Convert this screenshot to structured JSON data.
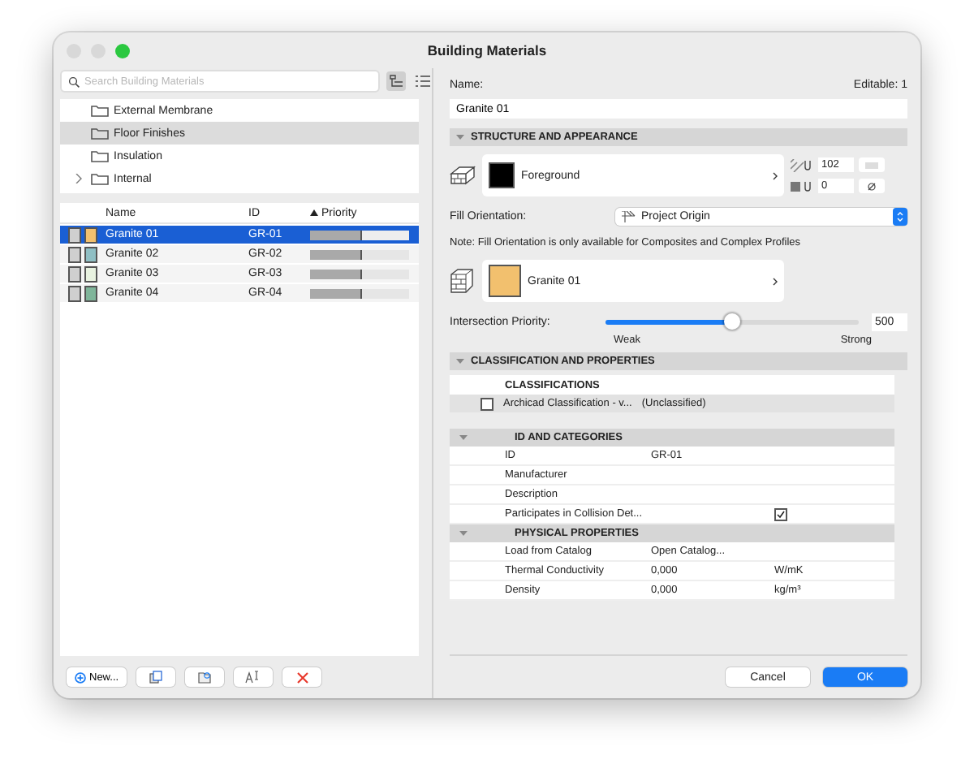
{
  "window": {
    "title": "Building Materials"
  },
  "search": {
    "placeholder": "Search Building Materials"
  },
  "view_toggle": [
    {
      "kind": "tree",
      "selected": true
    },
    {
      "kind": "list",
      "selected": false
    }
  ],
  "tree": {
    "items": [
      {
        "label": "External Membrane",
        "selected": false
      },
      {
        "label": "Floor Finishes",
        "selected": true
      },
      {
        "label": "Insulation",
        "selected": false
      },
      {
        "label": "Internal",
        "selected": false,
        "expanded": false
      }
    ]
  },
  "table": {
    "columns": [
      {
        "label": "Name",
        "sorted": false
      },
      {
        "label": "ID",
        "sorted": false
      },
      {
        "label": "Priority",
        "sorted": true
      }
    ],
    "rows": [
      {
        "name": "Granite 01",
        "id": "GR-01",
        "color": "#f2c06e",
        "level": 0.5,
        "selected": true
      },
      {
        "name": "Granite 02",
        "id": "GR-02",
        "color": "#8fbfc4",
        "level": 0.5,
        "selected": false
      },
      {
        "name": "Granite 03",
        "id": "GR-03",
        "color": "#e8f2e0",
        "level": 0.5,
        "selected": false
      },
      {
        "name": "Granite 04",
        "id": "GR-04",
        "color": "#7fb59a",
        "level": 0.5,
        "selected": false
      }
    ]
  },
  "left_buttons": [
    {
      "kind": "new",
      "label": "New..."
    },
    {
      "kind": "duplicate"
    },
    {
      "kind": "import"
    },
    {
      "kind": "rename"
    },
    {
      "kind": "delete"
    }
  ],
  "name": {
    "label": "Name:",
    "editable": "Editable: 1",
    "value": "Granite 01"
  },
  "structure": {
    "title": "STRUCTURE AND APPEARANCE",
    "expanded": true,
    "foreground": {
      "label": "Foreground",
      "color": "#000000"
    },
    "pen_fields": [
      "102",
      "0"
    ],
    "fill_orientation": {
      "label": "Fill Orientation:",
      "value": "Project Origin"
    },
    "note": "Note: Fill Orientation is only available for Composites and Complex Profiles",
    "surface": {
      "label": "Granite 01",
      "color": "#f2c06e"
    },
    "intersection": {
      "label": "Intersection Priority:",
      "level": 0.5,
      "value": "500",
      "min_label": "Weak",
      "max_label": "Strong"
    }
  },
  "classification": {
    "title": "CLASSIFICATION AND PROPERTIES",
    "expanded": true,
    "heading": "CLASSIFICATIONS",
    "rows": [
      {
        "name": "Archicad Classification - v...",
        "value": "(Unclassified)",
        "checked": false
      }
    ]
  },
  "properties": [
    {
      "title": "ID AND CATEGORIES",
      "expanded": true,
      "rows": [
        {
          "kind": "text",
          "name": "ID",
          "value": "GR-01"
        },
        {
          "kind": "text",
          "name": "Manufacturer"
        },
        {
          "kind": "text",
          "name": "Description"
        },
        {
          "kind": "checkbox",
          "name": "Participates in Collision Det...",
          "checked": true
        }
      ]
    },
    {
      "title": "PHYSICAL PROPERTIES",
      "expanded": true,
      "rows": [
        {
          "kind": "text",
          "name": "Load from Catalog",
          "value": "Open Catalog..."
        },
        {
          "kind": "text",
          "name": "Thermal Conductivity",
          "value": "0,000",
          "unit": "W/mK"
        },
        {
          "kind": "text",
          "name": "Density",
          "value": "0,000",
          "unit": "kg/m³"
        }
      ]
    }
  ],
  "footer": [
    {
      "label": "Cancel",
      "primary": false
    },
    {
      "label": "OK",
      "primary": true
    }
  ]
}
